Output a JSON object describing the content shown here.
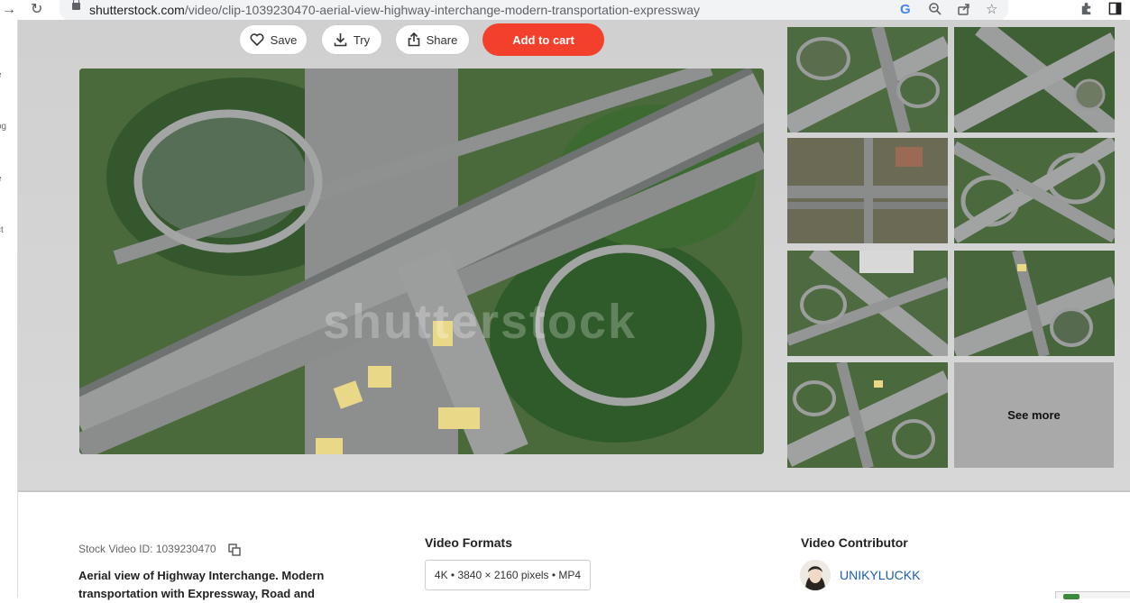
{
  "browser": {
    "url_host": "shutterstock.com",
    "url_path": "/video/clip-1039230470-aerial-view-highway-interchange-modern-transportation-expressway"
  },
  "actions": {
    "save_label": "Save",
    "try_label": "Try",
    "share_label": "Share",
    "cart_label": "Add to cart",
    "cart_color": "#f2402c"
  },
  "preview": {
    "watermark": "shutterstock"
  },
  "related": {
    "see_more_label": "See more"
  },
  "details": {
    "stock_id_text": "Stock Video ID: 1039230470",
    "description": "Aerial view of Highway Interchange. Modern transportation with Expressway, Road and",
    "formats_title": "Video Formats",
    "format_value": "4K • 3840 × 2160 pixels • MP4",
    "contributor_title": "Video Contributor",
    "contributor_name": "UNIKYLUCKK",
    "link_color": "#1a5fb4"
  },
  "sidebar_fragments": [
    "e",
    "og",
    "e",
    "ct"
  ]
}
